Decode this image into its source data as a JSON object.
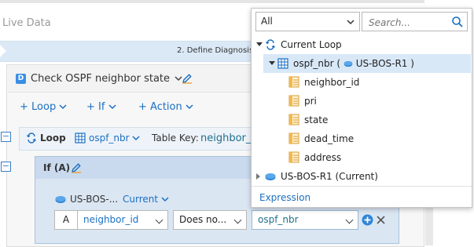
{
  "app": {
    "panel_title": "Live Data",
    "step_label": "2. Define Diagnosis"
  },
  "card": {
    "badge": "D",
    "title": "Check OSPF neighbor state"
  },
  "toolbar": {
    "loop_label": "+ Loop",
    "if_label": "+ If",
    "action_label": "+ Action"
  },
  "loop": {
    "collapse_glyph": "−",
    "label": "Loop",
    "table": "ospf_nbr",
    "table_key_label": "Table Key:",
    "table_key_value": "neighbor_i"
  },
  "if_block": {
    "collapse_glyph": "−",
    "label": "If (A)",
    "device": "US-BOS-...",
    "device_scope": "Current",
    "condition": {
      "tag": "A",
      "field": "neighbor_id",
      "operator": "Does no...",
      "value": "ospf_nbr"
    }
  },
  "popup": {
    "scope_selected": "All",
    "search_placeholder": "Search...",
    "tree": {
      "current_loop": "Current Loop",
      "table_name": "ospf_nbr (",
      "table_device": "US-BOS-R1 )",
      "fields": [
        "neighbor_id",
        "pri",
        "state",
        "dead_time",
        "address"
      ],
      "device_node": "US-BOS-R1 (Current)"
    },
    "expression_label": "Expression"
  },
  "colors": {
    "accent": "#1b6fc2",
    "teal": "#1f6f8b",
    "selected_row": "#d9e8f7",
    "if_block_bg": "#dbe6f3"
  }
}
